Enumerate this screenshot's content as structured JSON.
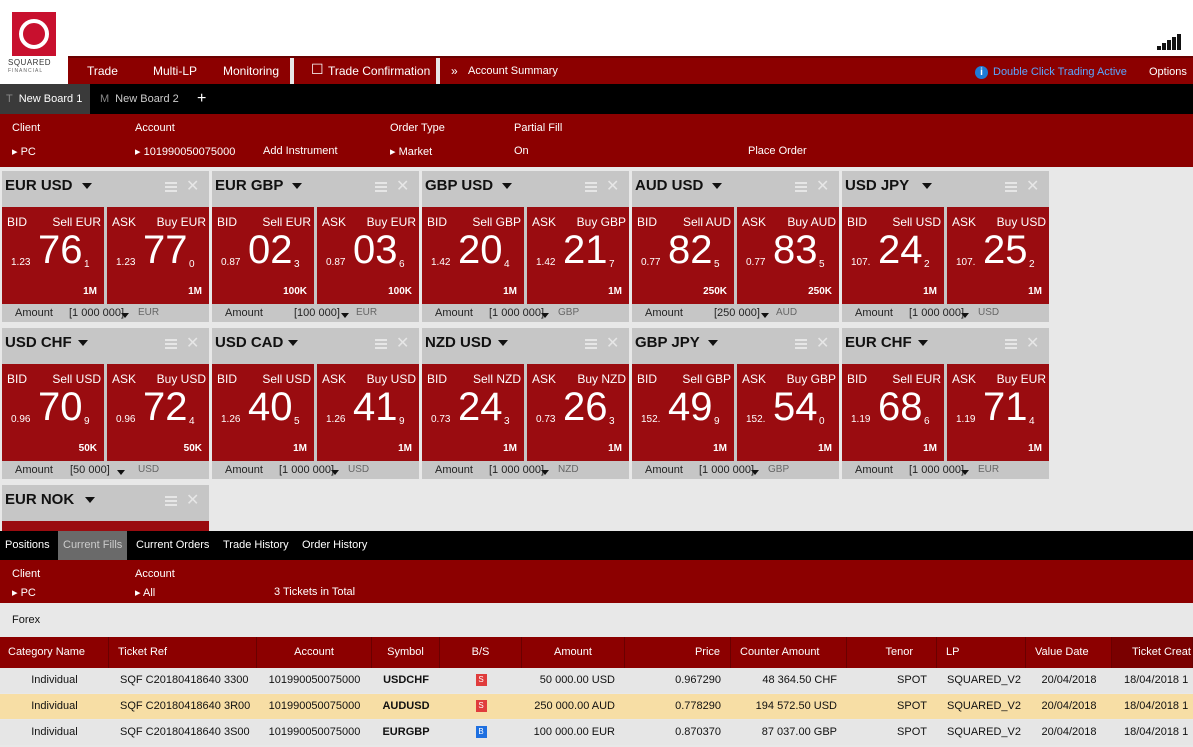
{
  "brand": {
    "line1": "SQUARED",
    "line2": "FINANCIAL"
  },
  "menu": {
    "trade": "Trade",
    "multi_lp": "Multi-LP",
    "monitoring": "Monitoring",
    "trade_confirmation": "Trade Confirmation",
    "account_summary": "Account Summary",
    "double_click": "Double Click Trading Active",
    "options": "Options"
  },
  "boards": [
    {
      "prefix": "T",
      "label": "New Board 1"
    },
    {
      "prefix": "M",
      "label": "New Board 2"
    }
  ],
  "add_board": "+",
  "order": {
    "client_label": "Client",
    "client_value": "PC",
    "account_label": "Account",
    "account_value": "101990050075000",
    "add_instrument": "Add Instrument",
    "order_type_label": "Order Type",
    "order_type_value": "Market",
    "partial_fill_label": "Partial Fill",
    "partial_fill_value": "On",
    "place_order": "Place Order"
  },
  "tile_labels": {
    "bid": "BID",
    "ask": "ASK",
    "amount": "Amount"
  },
  "tiles": [
    {
      "pair": "EUR USD",
      "sell": "Sell EUR",
      "buy": "Buy EUR",
      "bid": {
        "pre": "1.23",
        "big": "76",
        "pip": "1"
      },
      "ask": {
        "pre": "1.23",
        "big": "77",
        "pip": "0"
      },
      "bid_qty": "1M",
      "ask_qty": "1M",
      "amount": "[1 000 000]",
      "ccy": "EUR"
    },
    {
      "pair": "EUR GBP",
      "sell": "Sell EUR",
      "buy": "Buy EUR",
      "bid": {
        "pre": "0.87",
        "big": "02",
        "pip": "3"
      },
      "ask": {
        "pre": "0.87",
        "big": "03",
        "pip": "6"
      },
      "bid_qty": "100K",
      "ask_qty": "100K",
      "amount": "[100 000]",
      "ccy": "EUR"
    },
    {
      "pair": "GBP USD",
      "sell": "Sell GBP",
      "buy": "Buy GBP",
      "bid": {
        "pre": "1.42",
        "big": "20",
        "pip": "4"
      },
      "ask": {
        "pre": "1.42",
        "big": "21",
        "pip": "7"
      },
      "bid_qty": "1M",
      "ask_qty": "1M",
      "amount": "[1 000 000]",
      "ccy": "GBP"
    },
    {
      "pair": "AUD USD",
      "sell": "Sell AUD",
      "buy": "Buy AUD",
      "bid": {
        "pre": "0.77",
        "big": "82",
        "pip": "5"
      },
      "ask": {
        "pre": "0.77",
        "big": "83",
        "pip": "5"
      },
      "bid_qty": "250K",
      "ask_qty": "250K",
      "amount": "[250 000]",
      "ccy": "AUD"
    },
    {
      "pair": "USD JPY",
      "sell": "Sell USD",
      "buy": "Buy USD",
      "bid": {
        "pre": "107.",
        "big": "24",
        "pip": "2"
      },
      "ask": {
        "pre": "107.",
        "big": "25",
        "pip": "2"
      },
      "bid_qty": "1M",
      "ask_qty": "1M",
      "amount": "[1 000 000]",
      "ccy": "USD"
    },
    {
      "pair": "USD CHF",
      "sell": "Sell USD",
      "buy": "Buy USD",
      "bid": {
        "pre": "0.96",
        "big": "70",
        "pip": "9"
      },
      "ask": {
        "pre": "0.96",
        "big": "72",
        "pip": "4"
      },
      "bid_qty": "50K",
      "ask_qty": "50K",
      "amount": "[50 000]",
      "ccy": "USD"
    },
    {
      "pair": "USD CAD",
      "sell": "Sell USD",
      "buy": "Buy USD",
      "bid": {
        "pre": "1.26",
        "big": "40",
        "pip": "5"
      },
      "ask": {
        "pre": "1.26",
        "big": "41",
        "pip": "9"
      },
      "bid_qty": "1M",
      "ask_qty": "1M",
      "amount": "[1 000 000]",
      "ccy": "USD"
    },
    {
      "pair": "NZD USD",
      "sell": "Sell NZD",
      "buy": "Buy NZD",
      "bid": {
        "pre": "0.73",
        "big": "24",
        "pip": "3"
      },
      "ask": {
        "pre": "0.73",
        "big": "26",
        "pip": "3"
      },
      "bid_qty": "1M",
      "ask_qty": "1M",
      "amount": "[1 000 000]",
      "ccy": "NZD"
    },
    {
      "pair": "GBP JPY",
      "sell": "Sell GBP",
      "buy": "Buy GBP",
      "bid": {
        "pre": "152.",
        "big": "49",
        "pip": "9"
      },
      "ask": {
        "pre": "152.",
        "big": "54",
        "pip": "0"
      },
      "bid_qty": "1M",
      "ask_qty": "1M",
      "amount": "[1 000 000]",
      "ccy": "GBP"
    },
    {
      "pair": "EUR CHF",
      "sell": "Sell EUR",
      "buy": "Buy EUR",
      "bid": {
        "pre": "1.19",
        "big": "68",
        "pip": "6"
      },
      "ask": {
        "pre": "1.19",
        "big": "71",
        "pip": "4"
      },
      "bid_qty": "1M",
      "ask_qty": "1M",
      "amount": "[1 000 000]",
      "ccy": "EUR"
    },
    {
      "pair": "EUR NOK"
    }
  ],
  "bottom_tabs": [
    "Positions",
    "Current Fills",
    "Current Orders",
    "Trade History",
    "Order History"
  ],
  "filter": {
    "client_label": "Client",
    "client_value": "PC",
    "account_label": "Account",
    "account_value": "All",
    "tickets_total": "3 Tickets in Total"
  },
  "group_label": "Forex",
  "table": {
    "columns": [
      "Category Name",
      "Ticket Ref",
      "Account",
      "Symbol",
      "B/S",
      "Amount",
      "Price",
      "Counter Amount",
      "Tenor",
      "LP",
      "Value Date",
      "Ticket Creat"
    ],
    "rows": [
      [
        "Individual",
        "SQF C20180418640 3300",
        "101990050075000",
        "USDCHF",
        "S",
        "50 000.00 USD",
        "0.967290",
        "48 364.50 CHF",
        "SPOT",
        "SQUARED_V2",
        "20/04/2018",
        "18/04/2018 1"
      ],
      [
        "Individual",
        "SQF C20180418640 3R00",
        "101990050075000",
        "AUDUSD",
        "S",
        "250 000.00 AUD",
        "0.778290",
        "194 572.50 USD",
        "SPOT",
        "SQUARED_V2",
        "20/04/2018",
        "18/04/2018 1"
      ],
      [
        "Individual",
        "SQF C20180418640 3S00",
        "101990050075000",
        "EURGBP",
        "B",
        "100 000.00 EUR",
        "0.870370",
        "87 037.00 GBP",
        "SPOT",
        "SQUARED_V2",
        "20/04/2018",
        "18/04/2018 1"
      ]
    ]
  },
  "colors": {
    "brand_red": "#c8102e",
    "bar_red": "#8c0000",
    "tile_red": "#9a0c10",
    "sell_badge": "#e03c3c",
    "buy_badge": "#1e6fe0",
    "highlight_row": "#f7dea5",
    "info_blue": "#1e7bd6"
  }
}
